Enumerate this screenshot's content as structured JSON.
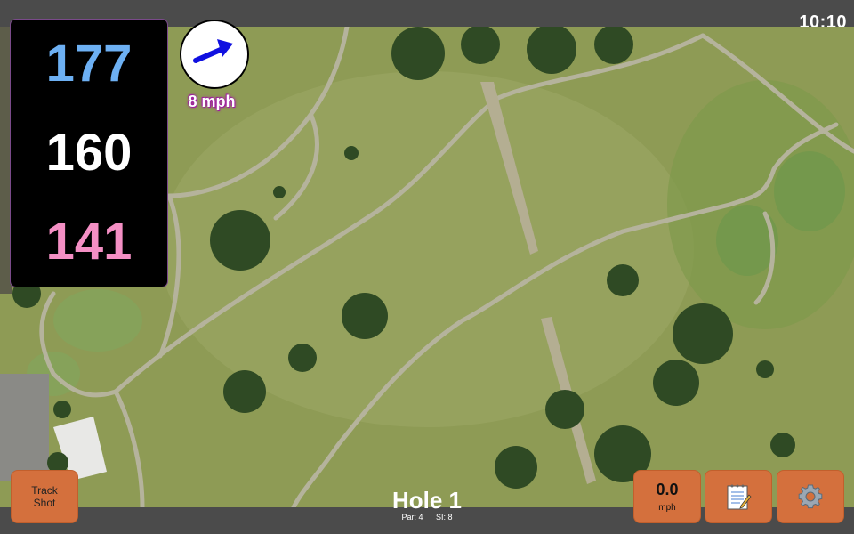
{
  "status": {
    "time": "10:10"
  },
  "distances": {
    "back": "177",
    "middle": "160",
    "front": "141"
  },
  "wind": {
    "speed": "8 mph",
    "arrow_icon": "wind-arrow-icon",
    "arrow_color": "#1010e0"
  },
  "hole": {
    "title": "Hole 1",
    "par": "Par: 4",
    "si": "SI: 8"
  },
  "buttons": {
    "track_shot_line1": "Track",
    "track_shot_line2": "Shot",
    "speed_value": "0.0",
    "speed_unit": "mph",
    "notes_icon": "notepad-icon",
    "settings_icon": "gear-icon"
  },
  "colors": {
    "back_distance": "#6db0f3",
    "middle_distance": "#ffffff",
    "front_distance": "#f48fc4",
    "button_accent": "#d4703d"
  }
}
